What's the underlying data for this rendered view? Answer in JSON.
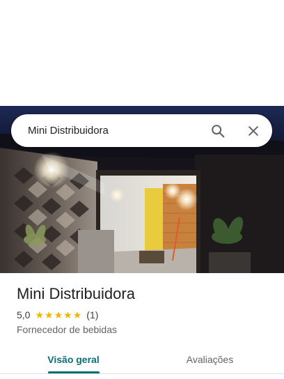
{
  "search": {
    "query": "Mini Distribuidora",
    "search_icon": "search-icon",
    "close_icon": "close-icon"
  },
  "place": {
    "name": "Mini Distribuidora",
    "rating": "5,0",
    "stars": 5,
    "review_count": "(1)",
    "category": "Fornecedor de bebidas"
  },
  "tabs": [
    {
      "label": "Visão geral",
      "active": true
    },
    {
      "label": "Avaliações",
      "active": false
    }
  ],
  "colors": {
    "accent": "#0b6e78",
    "star": "#f4b400"
  }
}
